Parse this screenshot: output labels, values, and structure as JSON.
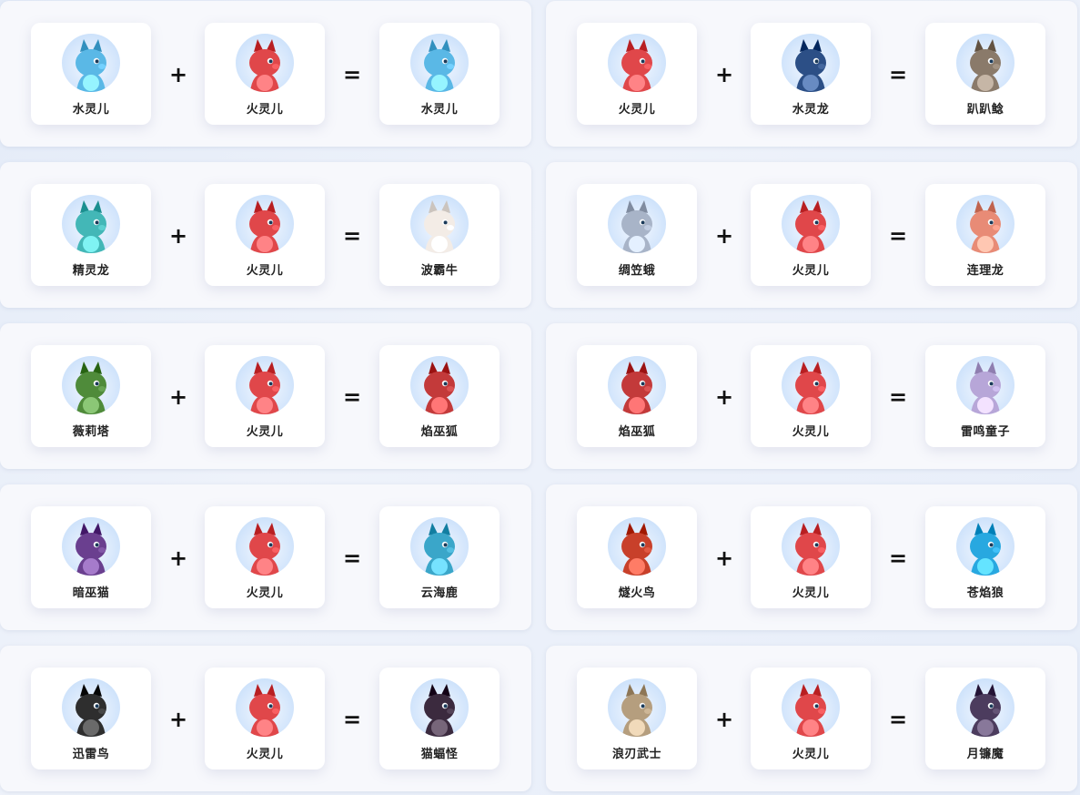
{
  "rows": [
    {
      "left": {
        "a": {
          "name": "水灵儿",
          "icon": "water-sprite-icon",
          "color": "#5ab8e6"
        },
        "b": {
          "name": "火灵儿",
          "icon": "fire-sprite-icon",
          "color": "#e0474a"
        },
        "plus": "+",
        "equals": "=",
        "result": {
          "name": "水灵儿",
          "icon": "water-sprite-icon",
          "color": "#5ab8e6"
        }
      },
      "right": {
        "a": {
          "name": "火灵儿",
          "icon": "fire-sprite-icon",
          "color": "#e0474a"
        },
        "b": {
          "name": "水灵龙",
          "icon": "water-dragon-icon",
          "color": "#2c4f86"
        },
        "plus": "+",
        "equals": "=",
        "result": {
          "name": "趴趴鲶",
          "icon": "catfish-icon",
          "color": "#8a7a6a"
        }
      }
    },
    {
      "left": {
        "a": {
          "name": "精灵龙",
          "icon": "sprite-dragon-icon",
          "color": "#43b7b7"
        },
        "b": {
          "name": "火灵儿",
          "icon": "fire-sprite-icon",
          "color": "#e0474a"
        },
        "plus": "+",
        "equals": "=",
        "result": {
          "name": "波霸牛",
          "icon": "cow-icon",
          "color": "#f3ece6"
        }
      },
      "right": {
        "a": {
          "name": "绸笠蛾",
          "icon": "moth-icon",
          "color": "#a8b4c8"
        },
        "b": {
          "name": "火灵儿",
          "icon": "fire-sprite-icon",
          "color": "#e0474a"
        },
        "plus": "+",
        "equals": "=",
        "result": {
          "name": "连理龙",
          "icon": "lotus-dragon-icon",
          "color": "#e88b76"
        }
      }
    },
    {
      "left": {
        "a": {
          "name": "薇莉塔",
          "icon": "plant-witch-icon",
          "color": "#4f8b3a"
        },
        "b": {
          "name": "火灵儿",
          "icon": "fire-sprite-icon",
          "color": "#e0474a"
        },
        "plus": "+",
        "equals": "=",
        "result": {
          "name": "焰巫狐",
          "icon": "flame-fox-icon",
          "color": "#c33a3a"
        }
      },
      "right": {
        "a": {
          "name": "焰巫狐",
          "icon": "flame-fox-icon",
          "color": "#c33a3a"
        },
        "b": {
          "name": "火灵儿",
          "icon": "fire-sprite-icon",
          "color": "#e0474a"
        },
        "plus": "+",
        "equals": "=",
        "result": {
          "name": "雷鸣童子",
          "icon": "thunder-child-icon",
          "color": "#b7a6d8"
        }
      }
    },
    {
      "left": {
        "a": {
          "name": "暗巫猫",
          "icon": "dark-witch-cat-icon",
          "color": "#6a3f8f"
        },
        "b": {
          "name": "火灵儿",
          "icon": "fire-sprite-icon",
          "color": "#e0474a"
        },
        "plus": "+",
        "equals": "=",
        "result": {
          "name": "云海鹿",
          "icon": "cloud-deer-icon",
          "color": "#3aa6c9"
        }
      },
      "right": {
        "a": {
          "name": "燧火鸟",
          "icon": "fire-bird-icon",
          "color": "#c8402a"
        },
        "b": {
          "name": "火灵儿",
          "icon": "fire-sprite-icon",
          "color": "#e0474a"
        },
        "plus": "+",
        "equals": "=",
        "result": {
          "name": "苍焰狼",
          "icon": "azure-wolf-icon",
          "color": "#28a8e0"
        }
      }
    },
    {
      "left": {
        "a": {
          "name": "迅雷鸟",
          "icon": "thunder-bird-icon",
          "color": "#2e2e2e"
        },
        "b": {
          "name": "火灵儿",
          "icon": "fire-sprite-icon",
          "color": "#e0474a"
        },
        "plus": "+",
        "equals": "=",
        "result": {
          "name": "猫蝠怪",
          "icon": "cat-bat-icon",
          "color": "#3b2a3e"
        }
      },
      "right": {
        "a": {
          "name": "浪刃武士",
          "icon": "samurai-icon",
          "color": "#b59e7e"
        },
        "b": {
          "name": "火灵儿",
          "icon": "fire-sprite-icon",
          "color": "#e0474a"
        },
        "plus": "+",
        "equals": "=",
        "result": {
          "name": "月镰魔",
          "icon": "moon-scythe-icon",
          "color": "#4c3c5e"
        }
      }
    }
  ]
}
